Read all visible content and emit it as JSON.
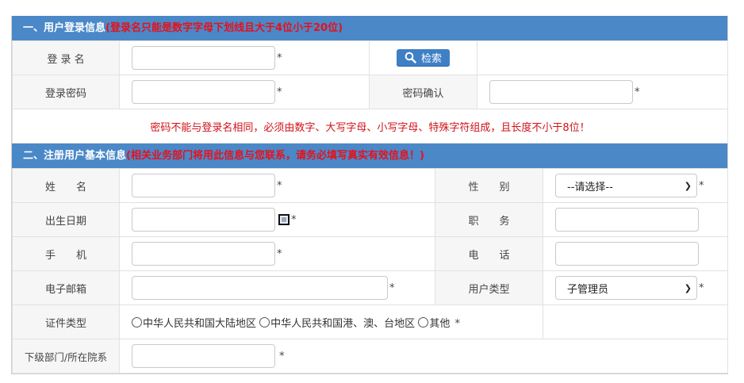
{
  "section1": {
    "title": "一、用户登录信息",
    "note": "(登录名只能是数字字母下划线且大于4位小于20位)",
    "login_name_label": "登 录 名",
    "search_label": "检索",
    "password_label": "登录密码",
    "confirm_label": "密码确认",
    "password_rule": "密码不能与登录名相同，必须由数字、大写字母、小写字母、特殊字符组成，且长度不小于8位！",
    "required_mark": "*"
  },
  "section2": {
    "title": "二、注册用户基本信息",
    "note": "(相关业务部门将用此信息与您联系，请务必填写真实有效信息！)",
    "name_label": "姓　　名",
    "gender_label": "性　　别",
    "gender_value": "--请选择--",
    "birth_label": "出生日期",
    "position_label": "职　　务",
    "mobile_label": "手　　机",
    "phone_label": "电　　话",
    "email_label": "电子邮箱",
    "usertype_label": "用户类型",
    "usertype_value": "子管理员",
    "idtype_label": "证件类型",
    "idtype_options": [
      "中华人民共和国大陆地区",
      "中华人民共和国港、澳、台地区",
      "其他"
    ],
    "dept_label": "下级部门/所在院系",
    "required_mark": "*"
  },
  "icons": [
    "search-icon",
    "calendar-icon",
    "chevron-down-icon"
  ],
  "colors": {
    "header_bg": "#4a88c8",
    "warning": "#d0121a",
    "button_bg": "#3f7fc6"
  }
}
